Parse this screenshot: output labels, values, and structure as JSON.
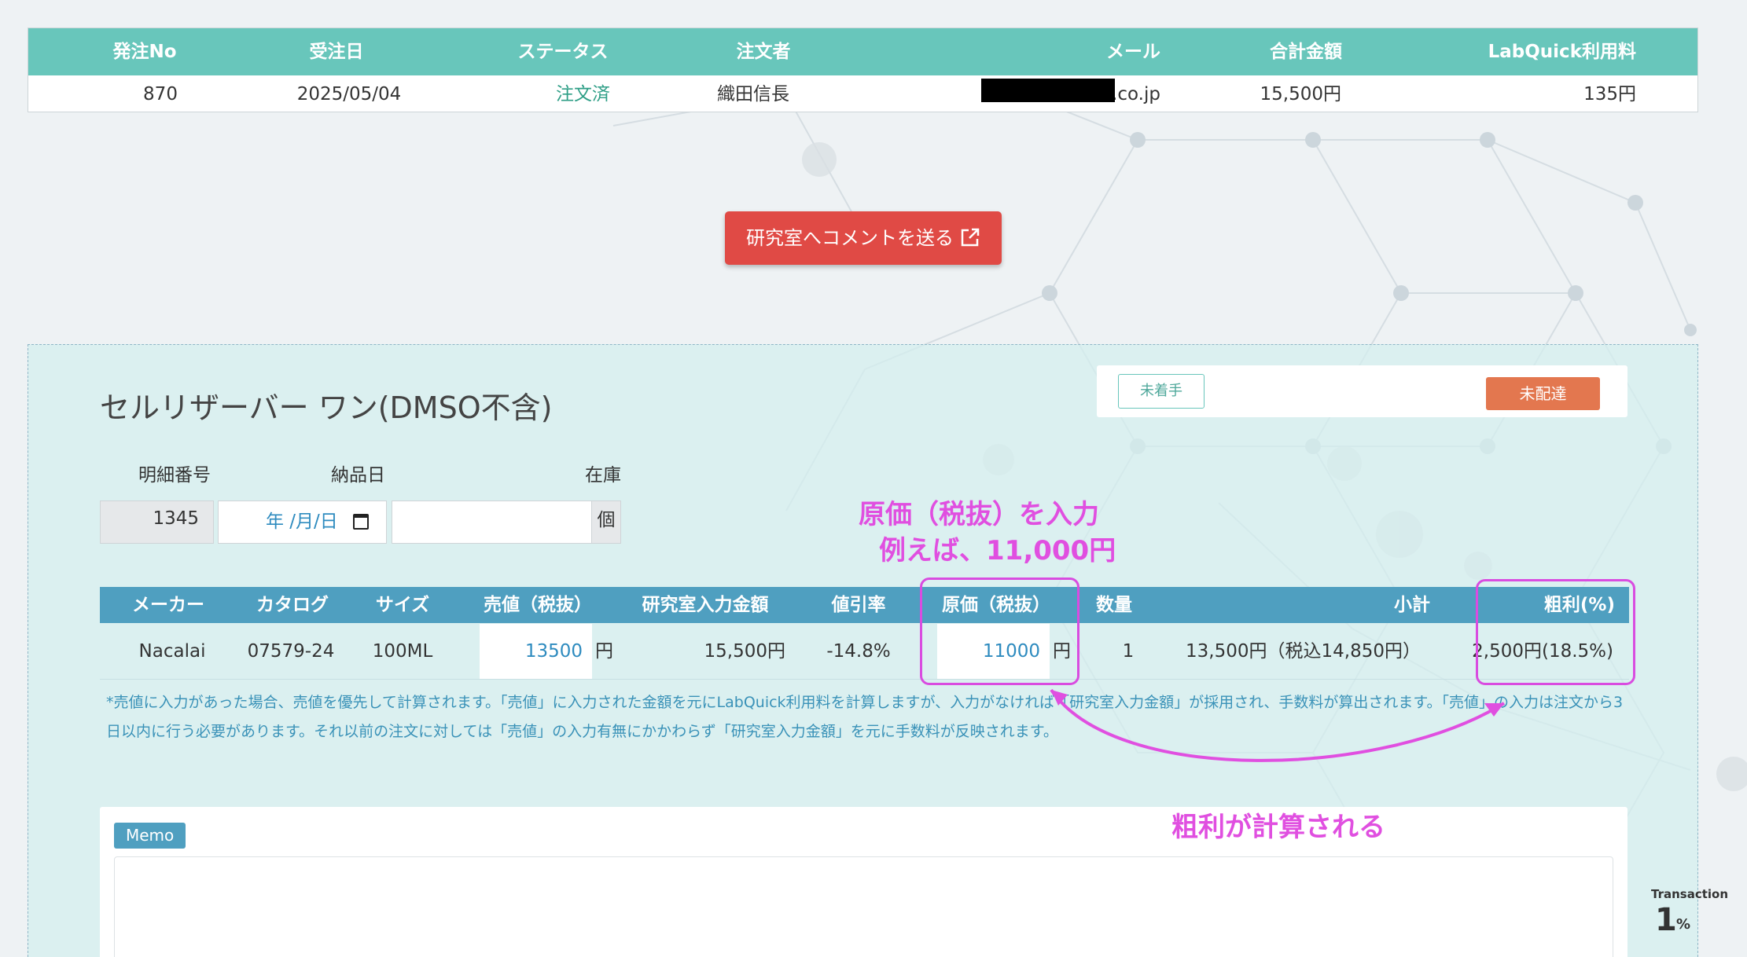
{
  "order_table": {
    "headers": [
      "発注No",
      "受注日",
      "ステータス",
      "注文者",
      "メール",
      "合計金額",
      "LabQuick利用料"
    ],
    "row": {
      "order_no": "870",
      "date": "2025/05/04",
      "status": "注文済",
      "orderer": "織田信長",
      "email_suffix": ".co.jp",
      "total": "15,500円",
      "fee": "135円"
    }
  },
  "comment_button": {
    "label": "研究室へコメントを送る",
    "icon": "external-link-icon"
  },
  "detail": {
    "status_buttons": {
      "not_started": "未着手",
      "not_delivered": "未配達"
    },
    "product_title": "セルリザーバー ワン(DMSO不含)",
    "fields": {
      "detail_no_label": "明細番号",
      "delivery_date_label": "納品日",
      "stock_label": "在庫",
      "detail_no_value": "1345",
      "date_placeholder": "年 /月/日",
      "stock_unit": "個"
    },
    "item_table": {
      "headers": [
        "メーカー",
        "カタログ",
        "サイズ",
        "売値（税抜）",
        "研究室入力金額",
        "値引率",
        "原価（税抜）",
        "数量",
        "小計",
        "粗利(%)"
      ],
      "row": {
        "maker": "Nacalai",
        "catalog": "07579-24",
        "size": "100ML",
        "sell_price": "13500",
        "yen": "円",
        "lab_price": "15,500円",
        "discount": "-14.8%",
        "cost": "11000",
        "qty": "1",
        "subtotal": "13,500円（税込14,850円）",
        "gross_profit": "2,500円(18.5%)"
      }
    },
    "note": "*売値に入力があった場合、売値を優先して計算されます。「売値」に入力された金額を元にLabQuick利用料を計算しますが、入力がなければ「研究室入力金額」が採用され、手数料が算出されます。「売値」の入力は注文から3日以内に行う必要があります。それ以前の注文に対しては「売値」の入力有無にかかわらず「研究室入力金額」を元に手数料が反映されます。",
    "memo_label": "Memo"
  },
  "annotations": {
    "cost_hint_line1": "原価（税抜）を入力",
    "cost_hint_line2": "例えば、11,000円",
    "profit_hint": "粗利が計算される",
    "color": "#e04fe0"
  },
  "transaction": {
    "label": "Transaction",
    "value": "1",
    "unit": "%"
  },
  "colors": {
    "header_teal": "#68c6bb",
    "header_blue": "#4f9fc0",
    "button_red": "#e04a45",
    "button_orange": "#e3774f"
  }
}
